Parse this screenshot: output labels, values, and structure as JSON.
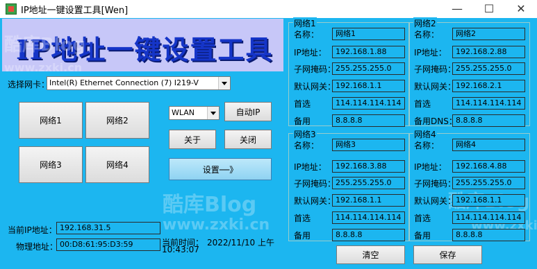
{
  "window": {
    "title": "IP地址一键设置工具[Wen]",
    "minimize": "—",
    "maximize": "☐",
    "close": "✕"
  },
  "banner": {
    "title": "IP地址一键设置工具"
  },
  "nic": {
    "label": "选择网卡：",
    "selected": "Intel(R) Ethernet Connection (7) I219-V"
  },
  "network_buttons": [
    "网络1",
    "网络2",
    "网络3",
    "网络4"
  ],
  "wlan": {
    "selected": "WLAN"
  },
  "buttons": {
    "auto_ip": "自动IP",
    "about": "关于",
    "close": "关闭",
    "settings": "设置──》",
    "clear": "清空",
    "save": "保存"
  },
  "status": {
    "current_ip_label": "当前IP地址：",
    "current_ip": "192.168.31.5",
    "mac_label": "物理地址：",
    "mac": "00:D8:61:95:D3:59",
    "time_label": "当前时间：",
    "time_line1": "2022/11/10 上午",
    "time_line2": "10:43:07"
  },
  "field_labels": {
    "name": "名称：",
    "ip": "IP地址：",
    "mask": "子网掩码：",
    "gateway": "默认网关：",
    "dns1": "首选",
    "dns2": "备用",
    "dns2_alt": "备用DNS："
  },
  "groups": [
    {
      "legend": "网络1",
      "name": "网络1",
      "ip": "192.168.1.88",
      "mask": "255.255.255.0",
      "gateway": "192.168.1.1",
      "dns1": "114.114.114.114",
      "dns2": "8.8.8.8"
    },
    {
      "legend": "网络2",
      "name": "网络2",
      "ip": "192.168.2.88",
      "mask": "255.255.255.0",
      "gateway": "192.168.2.1",
      "dns1": "114.114.114.114",
      "dns2": "8.8.8.8"
    },
    {
      "legend": "网络3",
      "name": "网络3",
      "ip": "192.168.3.88",
      "mask": "255.255.255.0",
      "gateway": "192.168.1.1",
      "dns1": "114.114.114.114",
      "dns2": "8.8.8.8"
    },
    {
      "legend": "网络4",
      "name": "网络4",
      "ip": "192.168.4.88",
      "mask": "255.255.255.0",
      "gateway": "192.168.1.1",
      "dns1": "114.114.114.114",
      "dns2": "8.8.8.8"
    }
  ],
  "watermark": {
    "brand": "酷库Blog",
    "url": "www.zxki.cn"
  }
}
